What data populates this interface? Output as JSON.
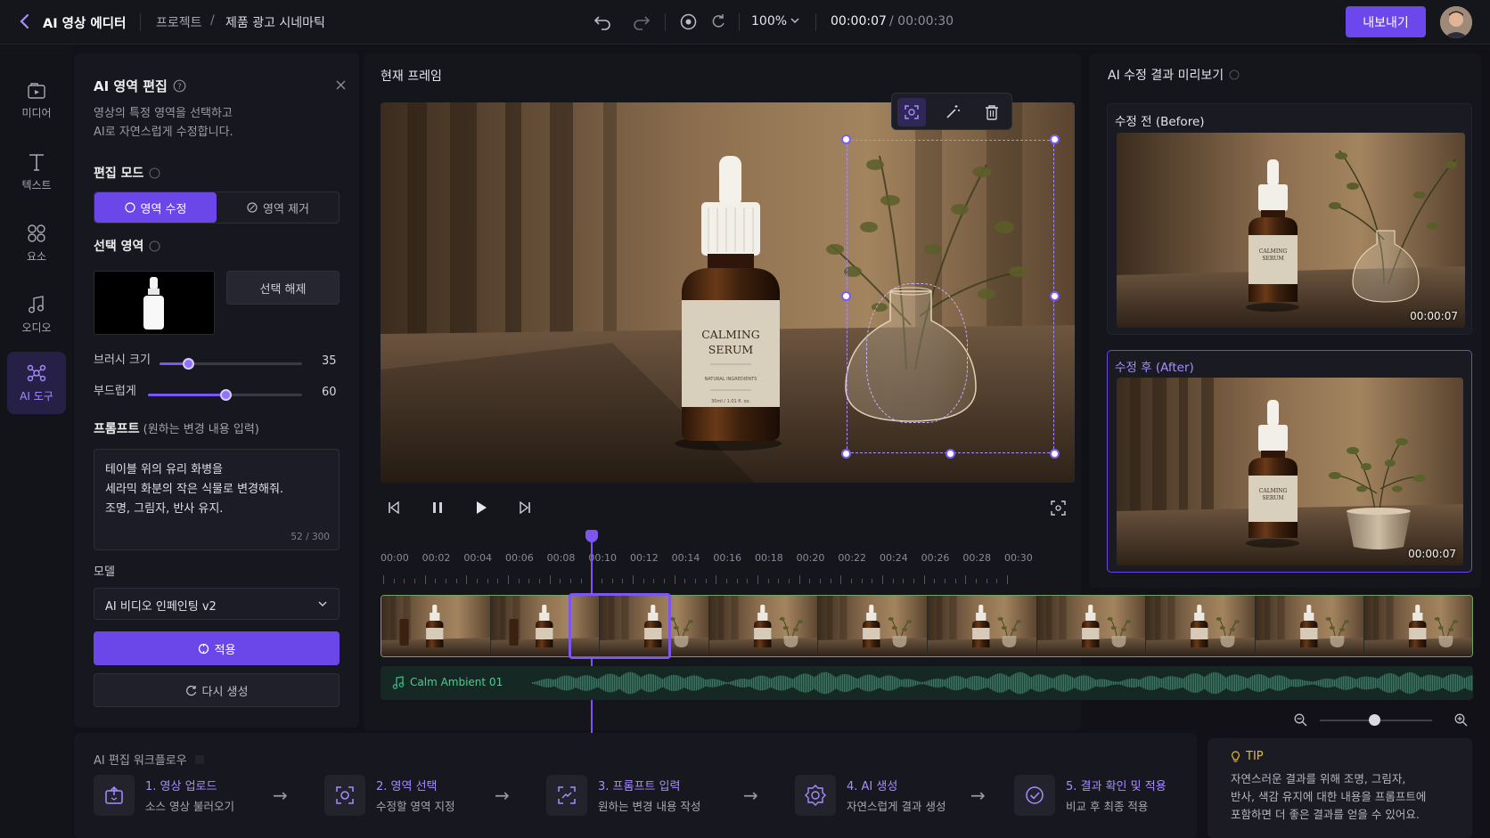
{
  "topbar": {
    "app_title": "AI 영상 에디터",
    "breadcrumb_root": "프로젝트",
    "breadcrumb_sep": "/",
    "breadcrumb_current": "제품 광고 시네마틱",
    "zoom": "100%",
    "time_current": "00:00:07",
    "time_total": "/ 00:00:30",
    "export_label": "내보내기"
  },
  "rail": {
    "items": [
      {
        "label": "미디어",
        "icon": "media-icon"
      },
      {
        "label": "텍스트",
        "icon": "text-icon"
      },
      {
        "label": "요소",
        "icon": "elements-icon"
      },
      {
        "label": "오디오",
        "icon": "audio-icon"
      },
      {
        "label": "AI 도구",
        "icon": "ai-tool-icon",
        "active": true
      }
    ]
  },
  "left_panel": {
    "title": "AI 영역 편집",
    "desc_1": "영상의 특정 영역을 선택하고",
    "desc_2": "AI로 자연스럽게 수정합니다.",
    "mode_label": "편집 모드",
    "mode_edit": "영역 수정",
    "mode_remove": "영역 제거",
    "selection_label": "선택 영역",
    "deselect": "선택 해제",
    "brush_label": "브러시 크기",
    "brush_value": "35",
    "brush_level": 0.2,
    "soft_label": "부드럽게",
    "soft_value": "60",
    "soft_level": 0.5,
    "prompt_label": "프롬프트",
    "prompt_hint": "(원하는 변경 내용 입력)",
    "prompt_line_1": "테이블 위의 유리 화병을",
    "prompt_line_2": "세라믹 화분의 작은 식물로 변경해줘.",
    "prompt_line_3": "조명, 그림자, 반사 유지.",
    "prompt_count": "52 / 300",
    "model_label": "모델",
    "model_value": "AI 비디오 인페인팅 v2",
    "apply": "적용",
    "regenerate": "다시 생성"
  },
  "center": {
    "title": "현재 프레임",
    "bottle_line_1": "CALMING",
    "bottle_line_2": "SERUM",
    "bottle_line_3": "NATURAL INGREDIENTS",
    "bottle_line_4": "30ml / 1.01 fl. oz.",
    "ticks": [
      "00:00",
      "00:02",
      "00:04",
      "00:06",
      "00:08",
      "00:10",
      "00:12",
      "00:14",
      "00:16",
      "00:18",
      "00:20",
      "00:22",
      "00:24",
      "00:26",
      "00:28",
      "00:30"
    ],
    "playhead_seconds": 10,
    "audio_name": "Calm Ambient 01"
  },
  "right": {
    "title": "AI 수정 결과 미리보기",
    "before_label": "수정 전 (Before)",
    "before_time": "00:00:07",
    "after_label": "수정 후 (After)",
    "after_time": "00:00:07",
    "thumb_line_1": "CALMING",
    "thumb_line_2": "SERUM"
  },
  "workflow": {
    "title": "AI 편집 워크플로우",
    "steps": [
      {
        "title": "1. 영상 업로드",
        "sub": "소스 영상 불러오기"
      },
      {
        "title": "2. 영역 선택",
        "sub": "수정할 영역 지정"
      },
      {
        "title": "3. 프롬프트 입력",
        "sub": "원하는 변경 내용 작성"
      },
      {
        "title": "4. AI 생성",
        "sub": "자연스럽게 결과 생성"
      },
      {
        "title": "5. 결과 확인 및 적용",
        "sub": "비교 후 최종 적용"
      }
    ],
    "arrow": "→"
  },
  "tip": {
    "title": "TIP",
    "line_1": "자연스러운 결과를 위해 조명, 그림자,",
    "line_2": "반사, 색감 유지에 대한 내용을 프롬프트에",
    "line_3": "포함하면 더 좋은 결과를 얻을 수 있어요."
  },
  "colors": {
    "accent": "#6c47ec",
    "accent_light": "#a88cff",
    "audio": "#1f9a6c",
    "bg": "#111117"
  }
}
